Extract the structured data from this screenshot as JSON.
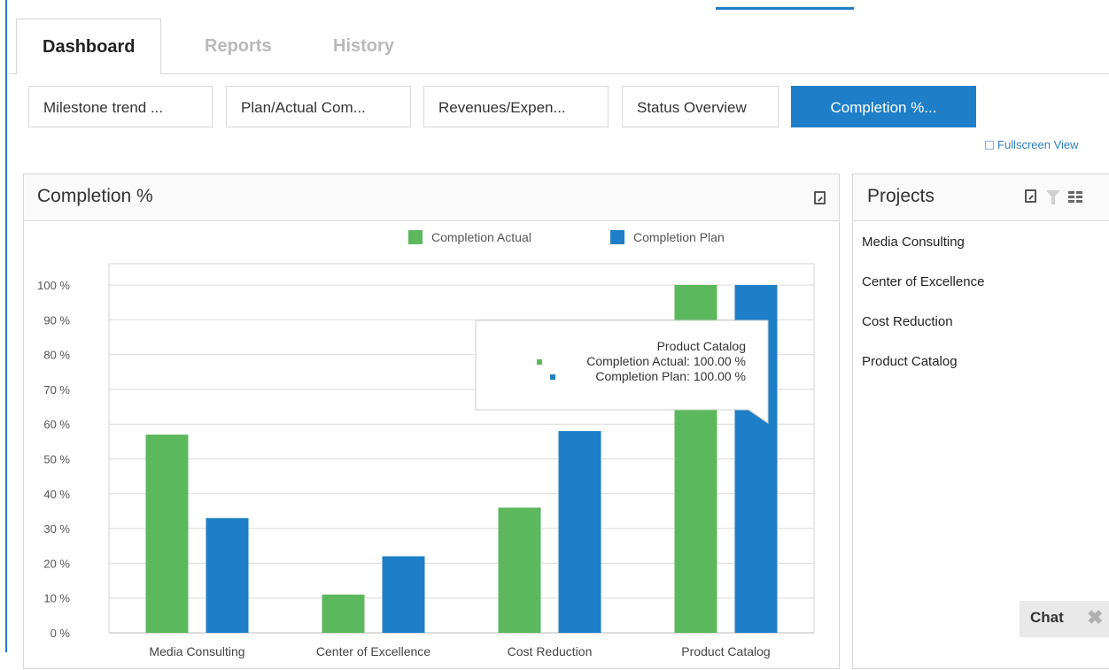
{
  "tabs": {
    "items": [
      "Dashboard",
      "Reports",
      "History"
    ],
    "active": 0
  },
  "subtabs": {
    "items": [
      "Milestone trend ...",
      "Plan/Actual Com...",
      "Revenues/Expen...",
      "Status Overview",
      "Completion %..."
    ],
    "active": 4
  },
  "fullscreen_label": "Fullscreen View",
  "chart_panel": {
    "title": "Completion %"
  },
  "projects_panel": {
    "title": "Projects",
    "items": [
      "Media Consulting",
      "Center of Excellence",
      "Cost Reduction",
      "Product Catalog"
    ]
  },
  "tooltip": {
    "title": "Product Catalog",
    "lines": [
      "Completion Actual: 100.00 %",
      "Completion Plan: 100.00 %"
    ]
  },
  "chat": {
    "label": "Chat",
    "close": "✖"
  },
  "colors": {
    "accent": "#1e7fc8",
    "actual": "#5cb85c",
    "plan": "#1e7fc8"
  },
  "chart_data": {
    "type": "bar",
    "categories": [
      "Media Consulting",
      "Center of Excellence",
      "Cost Reduction",
      "Product Catalog"
    ],
    "series": [
      {
        "name": "Completion Actual",
        "color": "#5cb85c",
        "values": [
          57,
          11,
          36,
          100
        ]
      },
      {
        "name": "Completion Plan",
        "color": "#1e7fc8",
        "values": [
          33,
          22,
          58,
          100
        ]
      }
    ],
    "yticks": [
      "0 %",
      "10 %",
      "20 %",
      "30 %",
      "40 %",
      "50 %",
      "60 %",
      "70 %",
      "80 %",
      "90 %",
      "100 %"
    ],
    "ylim": [
      0,
      100
    ],
    "grid": true,
    "legend_position": "top"
  }
}
